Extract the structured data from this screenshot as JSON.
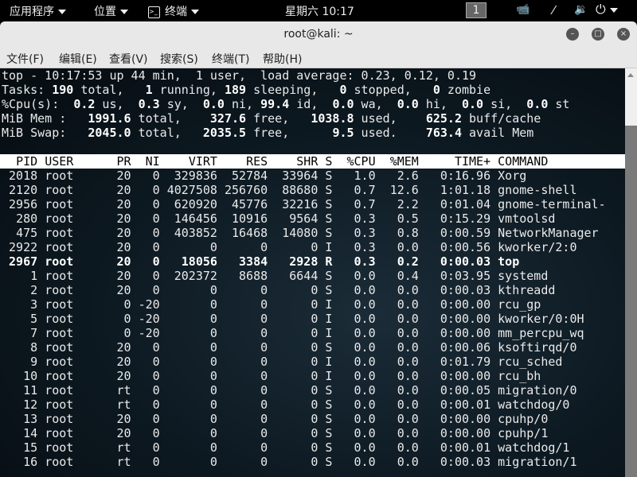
{
  "topbar": {
    "apps": "应用程序",
    "places": "位置",
    "terminal": "终端",
    "clock": "星期六 10:17",
    "workspace": "1"
  },
  "window": {
    "title": "root@kali: ~"
  },
  "menu": [
    "文件(F)",
    "编辑(E)",
    "查看(V)",
    "搜索(S)",
    "终端(T)",
    "帮助(H)"
  ],
  "summary": {
    "line1": "top - 10:17:53 up 44 min,  1 user,  load average: 0.23, 0.12, 0.19",
    "tasks": {
      "total": "190",
      "running": "1",
      "sleeping": "189",
      "stopped": "0",
      "zombie": "0"
    },
    "cpu": {
      "us": "0.2",
      "sy": "0.3",
      "ni": "0.0",
      "id": "99.4",
      "wa": "0.0",
      "hi": "0.0",
      "si": "0.0",
      "st": "0.0"
    },
    "mem": {
      "total": "1991.6",
      "free": "327.6",
      "used": "1038.8",
      "buff": "625.2"
    },
    "swap": {
      "total": "2045.0",
      "free": "2035.5",
      "used": "9.5",
      "avail": "763.4"
    }
  },
  "header": [
    "PID",
    "USER",
    "PR",
    "NI",
    "VIRT",
    "RES",
    "SHR",
    "S",
    "%CPU",
    "%MEM",
    "TIME+",
    "COMMAND"
  ],
  "processes": [
    [
      "2018",
      "root",
      "20",
      "0",
      "329836",
      "52784",
      "33964",
      "S",
      "1.0",
      "2.6",
      "0:16.96",
      "Xorg"
    ],
    [
      "2120",
      "root",
      "20",
      "0",
      "4027508",
      "256760",
      "88680",
      "S",
      "0.7",
      "12.6",
      "1:01.18",
      "gnome-shell"
    ],
    [
      "2956",
      "root",
      "20",
      "0",
      "620920",
      "45776",
      "32216",
      "S",
      "0.7",
      "2.2",
      "0:01.04",
      "gnome-terminal-"
    ],
    [
      "280",
      "root",
      "20",
      "0",
      "146456",
      "10916",
      "9564",
      "S",
      "0.3",
      "0.5",
      "0:15.29",
      "vmtoolsd"
    ],
    [
      "475",
      "root",
      "20",
      "0",
      "403852",
      "16468",
      "14080",
      "S",
      "0.3",
      "0.8",
      "0:00.59",
      "NetworkManager"
    ],
    [
      "2922",
      "root",
      "20",
      "0",
      "0",
      "0",
      "0",
      "I",
      "0.3",
      "0.0",
      "0:00.56",
      "kworker/2:0"
    ],
    [
      "2967",
      "root",
      "20",
      "0",
      "18056",
      "3384",
      "2928",
      "R",
      "0.3",
      "0.2",
      "0:00.03",
      "top"
    ],
    [
      "1",
      "root",
      "20",
      "0",
      "202372",
      "8688",
      "6644",
      "S",
      "0.0",
      "0.4",
      "0:03.95",
      "systemd"
    ],
    [
      "2",
      "root",
      "20",
      "0",
      "0",
      "0",
      "0",
      "S",
      "0.0",
      "0.0",
      "0:00.03",
      "kthreadd"
    ],
    [
      "3",
      "root",
      "0",
      "-20",
      "0",
      "0",
      "0",
      "I",
      "0.0",
      "0.0",
      "0:00.00",
      "rcu_gp"
    ],
    [
      "5",
      "root",
      "0",
      "-20",
      "0",
      "0",
      "0",
      "I",
      "0.0",
      "0.0",
      "0:00.00",
      "kworker/0:0H"
    ],
    [
      "7",
      "root",
      "0",
      "-20",
      "0",
      "0",
      "0",
      "I",
      "0.0",
      "0.0",
      "0:00.00",
      "mm_percpu_wq"
    ],
    [
      "8",
      "root",
      "20",
      "0",
      "0",
      "0",
      "0",
      "S",
      "0.0",
      "0.0",
      "0:00.06",
      "ksoftirqd/0"
    ],
    [
      "9",
      "root",
      "20",
      "0",
      "0",
      "0",
      "0",
      "I",
      "0.0",
      "0.0",
      "0:01.79",
      "rcu_sched"
    ],
    [
      "10",
      "root",
      "20",
      "0",
      "0",
      "0",
      "0",
      "I",
      "0.0",
      "0.0",
      "0:00.00",
      "rcu_bh"
    ],
    [
      "11",
      "root",
      "rt",
      "0",
      "0",
      "0",
      "0",
      "S",
      "0.0",
      "0.0",
      "0:00.05",
      "migration/0"
    ],
    [
      "12",
      "root",
      "rt",
      "0",
      "0",
      "0",
      "0",
      "S",
      "0.0",
      "0.0",
      "0:00.01",
      "watchdog/0"
    ],
    [
      "13",
      "root",
      "20",
      "0",
      "0",
      "0",
      "0",
      "S",
      "0.0",
      "0.0",
      "0:00.00",
      "cpuhp/0"
    ],
    [
      "14",
      "root",
      "20",
      "0",
      "0",
      "0",
      "0",
      "S",
      "0.0",
      "0.0",
      "0:00.00",
      "cpuhp/1"
    ],
    [
      "15",
      "root",
      "rt",
      "0",
      "0",
      "0",
      "0",
      "S",
      "0.0",
      "0.0",
      "0:00.01",
      "watchdog/1"
    ],
    [
      "16",
      "root",
      "rt",
      "0",
      "0",
      "0",
      "0",
      "S",
      "0.0",
      "0.0",
      "0:00.03",
      "migration/1"
    ]
  ],
  "running_pid": "2967"
}
